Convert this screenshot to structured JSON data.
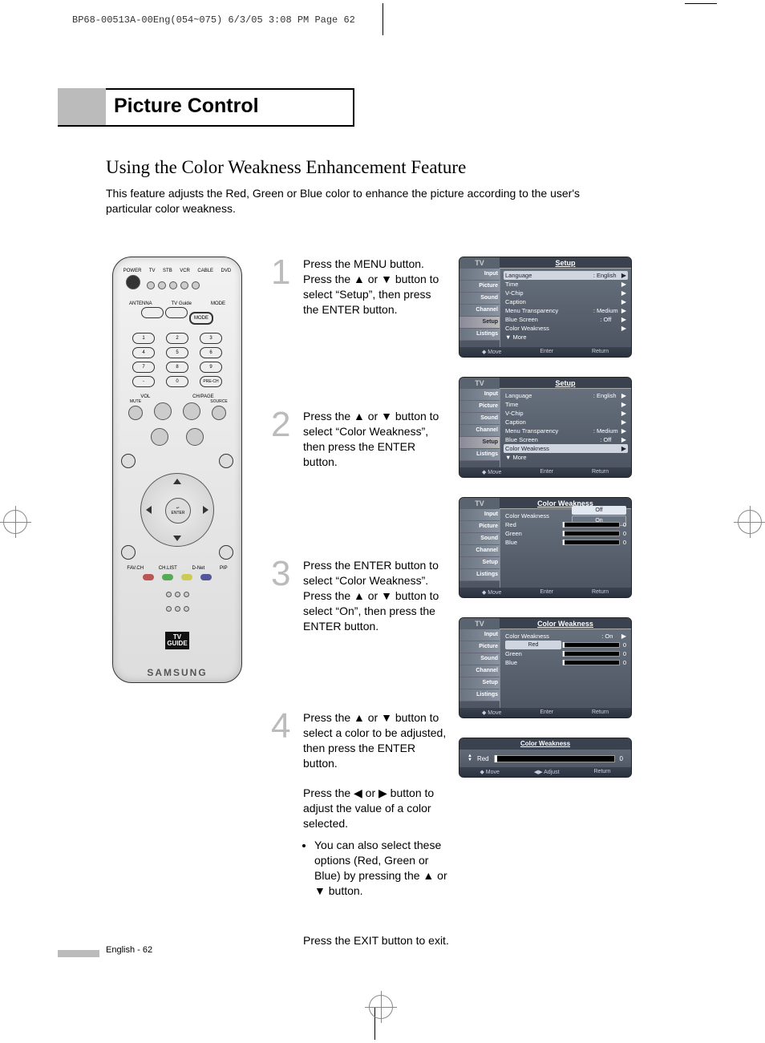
{
  "headerLine": "BP68-00513A-00Eng(054~075)  6/3/05  3:08 PM  Page 62",
  "sectionTitle": "Picture Control",
  "subheading": "Using the Color Weakness Enhancement Feature",
  "intro": "This feature adjusts the Red, Green or Blue color to enhance the picture according to the user's particular color weakness.",
  "remote": {
    "brand": "SAMSUNG",
    "topLabels": [
      "TV",
      "STB",
      "VCR",
      "CABLE",
      "DVD"
    ],
    "power": "POWER",
    "antenna": "ANTENNA",
    "tvguide": "TV Guide",
    "mode": "MODE",
    "nums": [
      "1",
      "2",
      "3",
      "4",
      "5",
      "6",
      "7",
      "8",
      "9",
      "-",
      "0",
      "PRE-CH"
    ],
    "vol": "VOL",
    "chpage": "CH/PAGE",
    "mute": "MUTE",
    "source": "SOURCE",
    "enter": "ENTER",
    "favch": "FAV.CH",
    "chlist": "CH.LIST",
    "dnet": "D-Net",
    "pip": "PIP",
    "tvGuideLogo1": "TV",
    "tvGuideLogo2": "GUIDE"
  },
  "steps": {
    "s1": {
      "num": "1",
      "text": "Press the MENU button. Press the ▲ or ▼ button to select “Setup”, then press the ENTER button."
    },
    "s2": {
      "num": "2",
      "text": "Press the ▲ or ▼ button to select “Color Weakness”, then press the ENTER button."
    },
    "s3": {
      "num": "3",
      "text": "Press the ENTER button to select “Color Weakness”. Press the ▲ or ▼ button to select “On”, then press the ENTER button."
    },
    "s4": {
      "num": "4",
      "textA": "Press the ▲ or ▼ button to select a color to be adjusted, then press the ENTER button.",
      "textB": "Press the ◀ or ▶ button to adjust the value of a color selected.",
      "bullet": "You can also select these options (Red, Green or Blue) by pressing the ▲ or ▼ button."
    },
    "exit": "Press the EXIT button to exit."
  },
  "osdCommon": {
    "tv": "TV",
    "sidebar": [
      "Input",
      "Picture",
      "Sound",
      "Channel",
      "Setup",
      "Listings"
    ],
    "footerMove": "◆ Move",
    "footerEnter": "Enter",
    "footerReturn": "Return",
    "footerAdjust": "◀▶ Adjust"
  },
  "osd1": {
    "title": "Setup",
    "rows": [
      {
        "label": "Language",
        "value": ": English",
        "arrow": "▶"
      },
      {
        "label": "Time",
        "value": "",
        "arrow": "▶"
      },
      {
        "label": "V-Chip",
        "value": "",
        "arrow": "▶"
      },
      {
        "label": "Caption",
        "value": "",
        "arrow": "▶"
      },
      {
        "label": "Menu Transparency",
        "value": ": Medium",
        "arrow": "▶"
      },
      {
        "label": "Blue Screen",
        "value": ": Off",
        "arrow": "▶"
      },
      {
        "label": "Color Weakness",
        "value": "",
        "arrow": "▶"
      },
      {
        "label": "▼ More",
        "value": "",
        "arrow": ""
      }
    ],
    "highlightIndex": 0
  },
  "osd2": {
    "title": "Setup",
    "highlightIndex": 6
  },
  "osd3": {
    "title": "Color Weakness",
    "rows": [
      {
        "label": "Color Weakness",
        "option1": "Off",
        "option2": "On"
      },
      {
        "label": "Red",
        "val": "0"
      },
      {
        "label": "Green",
        "val": "0"
      },
      {
        "label": "Blue",
        "val": "0"
      }
    ]
  },
  "osd4": {
    "title": "Color Weakness",
    "rows": [
      {
        "label": "Color Weakness",
        "value": ": On",
        "arrow": "▶"
      },
      {
        "label": "Red",
        "val": "0",
        "highlight": true
      },
      {
        "label": "Green",
        "val": "0"
      },
      {
        "label": "Blue",
        "val": "0"
      }
    ]
  },
  "osdMini": {
    "title": "Color Weakness",
    "label": "Red",
    "val": "0"
  },
  "pageNum": "English - 62"
}
